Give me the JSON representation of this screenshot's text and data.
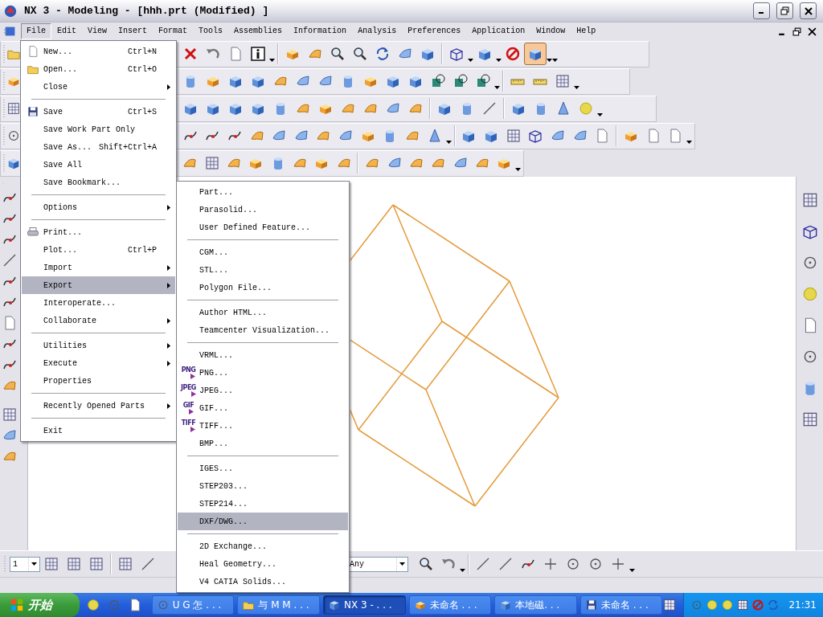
{
  "window": {
    "title": "NX 3 - Modeling - [hhh.prt (Modified) ]"
  },
  "menubar": [
    {
      "label": "File",
      "selected": true
    },
    {
      "label": "Edit",
      "selected": false
    },
    {
      "label": "View",
      "selected": false
    },
    {
      "label": "Insert",
      "selected": false
    },
    {
      "label": "Format",
      "selected": false
    },
    {
      "label": "Tools",
      "selected": false
    },
    {
      "label": "Assemblies",
      "selected": false
    },
    {
      "label": "Information",
      "selected": false
    },
    {
      "label": "Analysis",
      "selected": false
    },
    {
      "label": "Preferences",
      "selected": false
    },
    {
      "label": "Application",
      "selected": false
    },
    {
      "label": "Window",
      "selected": false
    },
    {
      "label": "Help",
      "selected": false
    }
  ],
  "view_toolbar": {
    "shaded_selected": true
  },
  "file_menu": [
    {
      "kind": "item",
      "label": "New...",
      "shortcut": "Ctrl+N",
      "submenu": false,
      "selected": false
    },
    {
      "kind": "item",
      "label": "Open...",
      "shortcut": "Ctrl+O",
      "submenu": false,
      "selected": false
    },
    {
      "kind": "item",
      "label": "Close",
      "submenu": true,
      "selected": false
    },
    {
      "kind": "separator"
    },
    {
      "kind": "item",
      "label": "Save",
      "shortcut": "Ctrl+S",
      "submenu": false,
      "selected": false
    },
    {
      "kind": "item",
      "label": "Save Work Part Only",
      "submenu": false,
      "selected": false
    },
    {
      "kind": "item",
      "label": "Save As...",
      "shortcut": "Shift+Ctrl+A",
      "submenu": false,
      "selected": false
    },
    {
      "kind": "item",
      "label": "Save All",
      "submenu": false,
      "selected": false
    },
    {
      "kind": "item",
      "label": "Save Bookmark...",
      "submenu": false,
      "selected": false
    },
    {
      "kind": "separator"
    },
    {
      "kind": "item",
      "label": "Options",
      "submenu": true,
      "selected": false
    },
    {
      "kind": "separator"
    },
    {
      "kind": "item",
      "label": "Print...",
      "submenu": false,
      "selected": false
    },
    {
      "kind": "item",
      "label": "Plot...",
      "shortcut": "Ctrl+P",
      "submenu": false,
      "selected": false
    },
    {
      "kind": "item",
      "label": "Import",
      "submenu": true,
      "selected": false
    },
    {
      "kind": "item",
      "label": "Export",
      "submenu": true,
      "selected": true
    },
    {
      "kind": "item",
      "label": "Interoperate...",
      "submenu": false,
      "selected": false
    },
    {
      "kind": "item",
      "label": "Collaborate",
      "submenu": true,
      "selected": false
    },
    {
      "kind": "separator"
    },
    {
      "kind": "item",
      "label": "Utilities",
      "submenu": true,
      "selected": false
    },
    {
      "kind": "item",
      "label": "Execute",
      "submenu": true,
      "selected": false
    },
    {
      "kind": "item",
      "label": "Properties",
      "submenu": false,
      "selected": false
    },
    {
      "kind": "separator"
    },
    {
      "kind": "item",
      "label": "Recently Opened Parts",
      "submenu": true,
      "selected": false
    },
    {
      "kind": "separator"
    },
    {
      "kind": "item",
      "label": "Exit",
      "submenu": false,
      "selected": false
    }
  ],
  "export_menu": [
    {
      "kind": "item",
      "label": "Part...",
      "selected": false
    },
    {
      "kind": "item",
      "label": "Parasolid...",
      "selected": false
    },
    {
      "kind": "item",
      "label": "User Defined Feature...",
      "selected": false
    },
    {
      "kind": "separator"
    },
    {
      "kind": "item",
      "label": "CGM...",
      "selected": false
    },
    {
      "kind": "item",
      "label": "STL...",
      "selected": false
    },
    {
      "kind": "item",
      "label": "Polygon File...",
      "selected": false
    },
    {
      "kind": "separator"
    },
    {
      "kind": "item",
      "label": "Author HTML...",
      "selected": false
    },
    {
      "kind": "item",
      "label": "Teamcenter Visualization...",
      "selected": false
    },
    {
      "kind": "separator"
    },
    {
      "kind": "item",
      "label": "VRML...",
      "selected": false
    },
    {
      "kind": "item",
      "label": "PNG...",
      "icon_text": "PNG",
      "selected": false
    },
    {
      "kind": "item",
      "label": "JPEG...",
      "icon_text": "JPEG",
      "selected": false
    },
    {
      "kind": "item",
      "label": "GIF...",
      "icon_text": "GIF",
      "selected": false
    },
    {
      "kind": "item",
      "label": "TIFF...",
      "icon_text": "TIFF",
      "selected": false
    },
    {
      "kind": "item",
      "label": "BMP...",
      "selected": false
    },
    {
      "kind": "separator"
    },
    {
      "kind": "item",
      "label": "IGES...",
      "selected": false
    },
    {
      "kind": "item",
      "label": "STEP203...",
      "selected": false
    },
    {
      "kind": "item",
      "label": "STEP214...",
      "selected": false
    },
    {
      "kind": "item",
      "label": "DXF/DWG...",
      "selected": true
    },
    {
      "kind": "separator"
    },
    {
      "kind": "item",
      "label": "2D Exchange...",
      "selected": false
    },
    {
      "kind": "item",
      "label": "Heal Geometry...",
      "selected": false
    },
    {
      "kind": "item",
      "label": "V4 CATIA Solids...",
      "selected": false
    }
  ],
  "selection_bar": {
    "layer": "1",
    "filter": "Any"
  },
  "taskbar": {
    "start": "开始",
    "tasks": [
      {
        "label": "U G 怎 . . .",
        "selected": false
      },
      {
        "label": "与 M M . . .",
        "selected": false
      },
      {
        "label": "NX 3 - . . .",
        "selected": true
      },
      {
        "label": "未命名 . . .",
        "selected": false
      },
      {
        "label": "本地磁. . .",
        "selected": false
      },
      {
        "label": "未命名 . . .",
        "selected": false
      }
    ],
    "clock": "21:31"
  }
}
